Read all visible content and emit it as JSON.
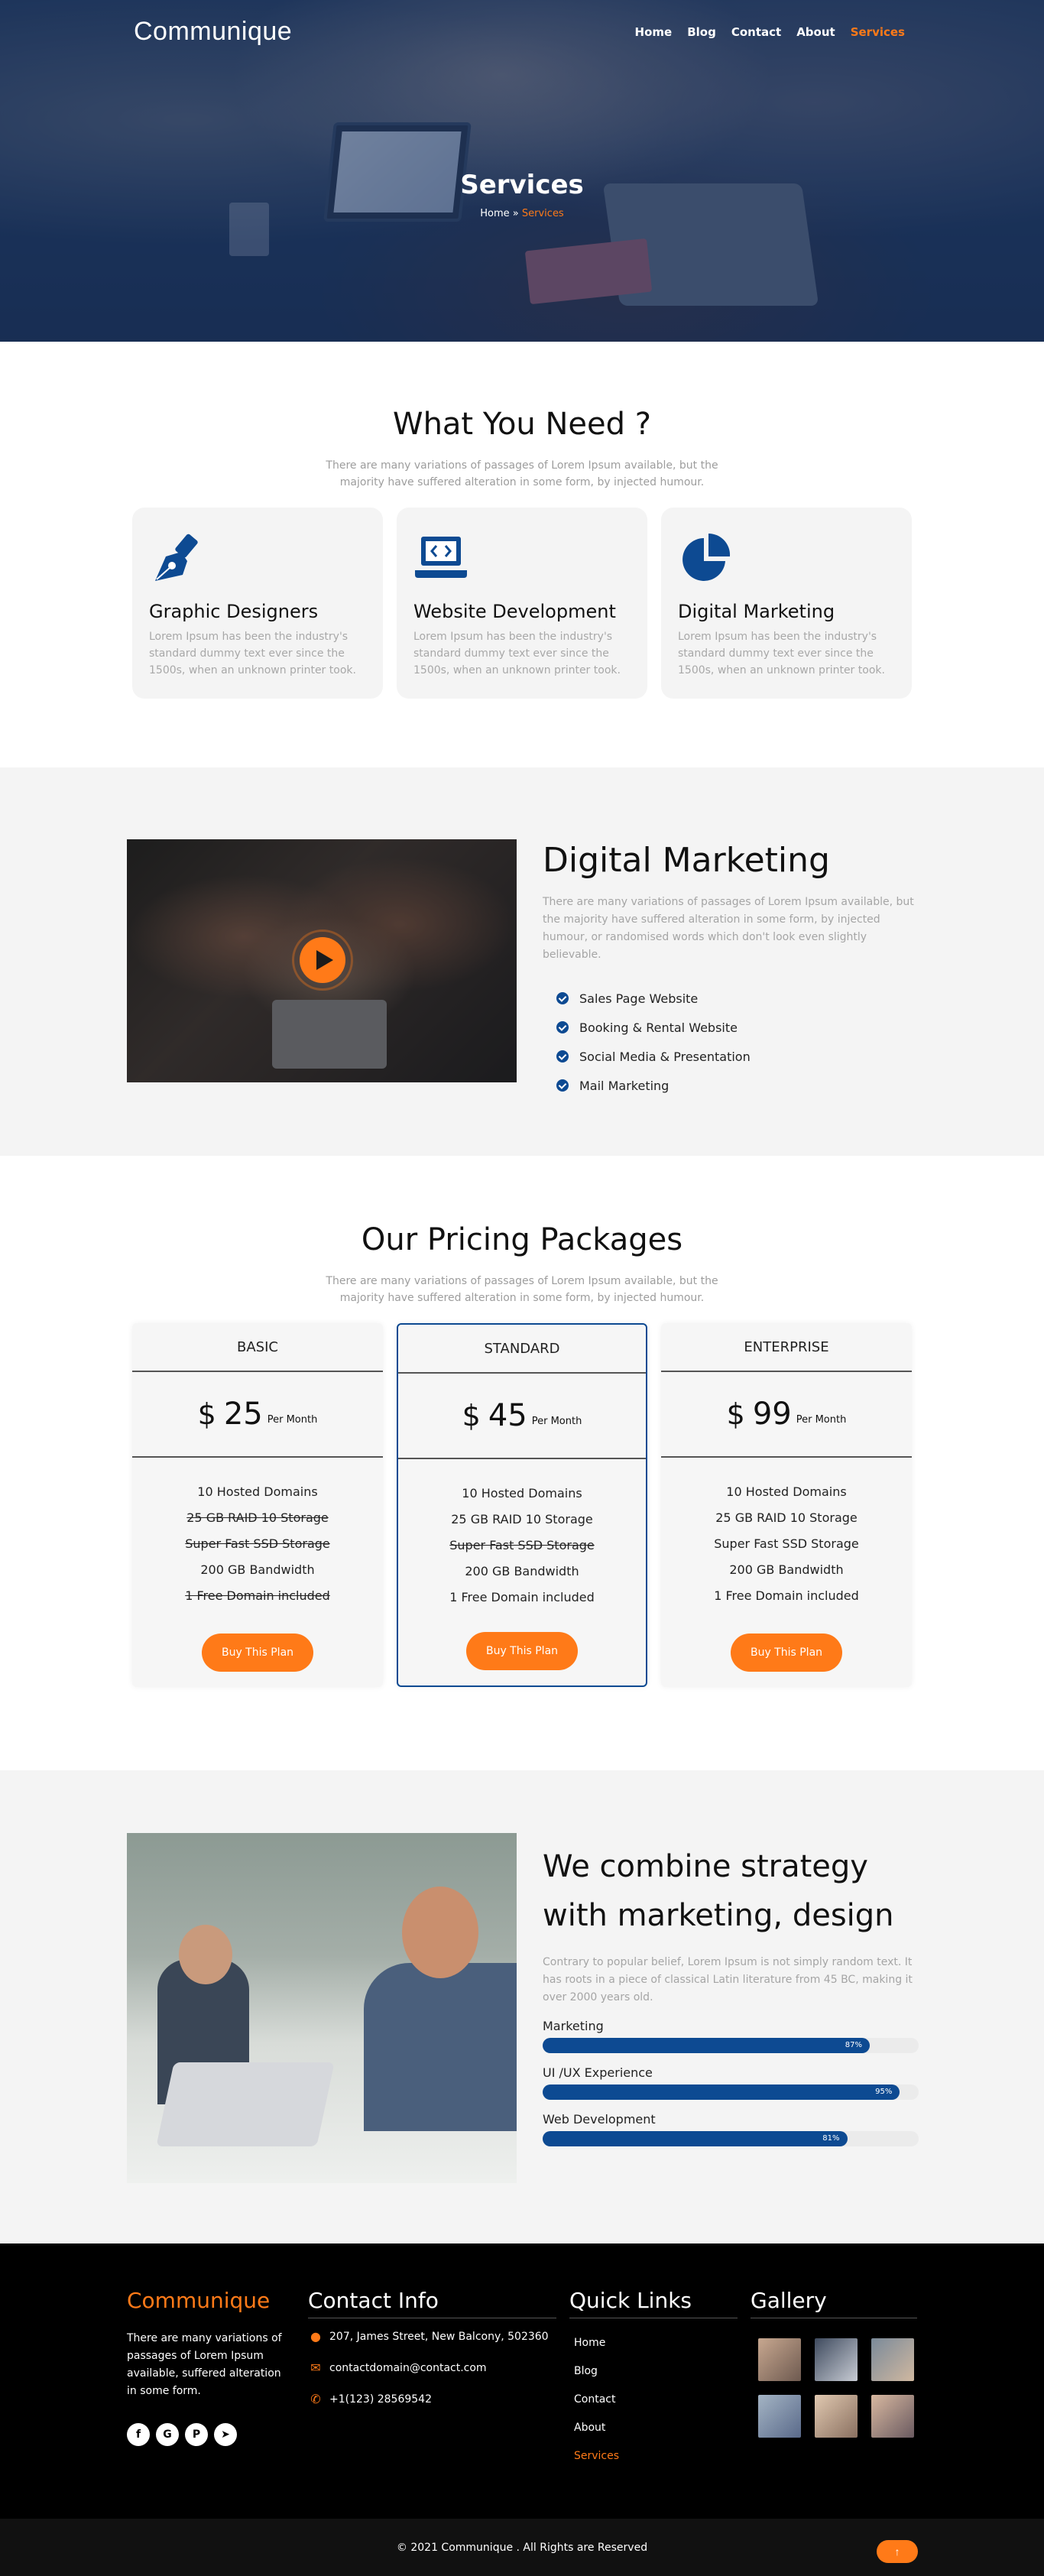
{
  "brand": "Communique",
  "nav": {
    "items": [
      {
        "label": "Home",
        "active": false
      },
      {
        "label": "Blog",
        "active": false
      },
      {
        "label": "Contact",
        "active": false
      },
      {
        "label": "About",
        "active": false
      },
      {
        "label": "Services",
        "active": true
      }
    ]
  },
  "hero": {
    "title": "Services",
    "breadcrumb_home": "Home",
    "breadcrumb_sep": " » ",
    "breadcrumb_current": "Services"
  },
  "services": {
    "title": "What You Need ?",
    "subtitle": "There are many variations of passages of Lorem Ipsum available, but the majority have suffered alteration in some form, by injected humour.",
    "cards": [
      {
        "icon": "pen-nib-icon",
        "title": "Graphic Designers",
        "text": "Lorem Ipsum has been the industry's standard dummy text ever since the 1500s, when an unknown printer took."
      },
      {
        "icon": "laptop-code-icon",
        "title": "Website Development",
        "text": "Lorem Ipsum has been the industry's standard dummy text ever since the 1500s, when an unknown printer took."
      },
      {
        "icon": "pie-chart-icon",
        "title": "Digital Marketing",
        "text": "Lorem Ipsum has been the industry's standard dummy text ever since the 1500s, when an unknown printer took."
      }
    ]
  },
  "digital_marketing": {
    "title": "Digital Marketing",
    "text": "There are many variations of passages of Lorem Ipsum available, but the majority have suffered alteration in some form, by injected humour, or randomised words which don't look even slightly believable.",
    "list": [
      "Sales Page Website",
      "Booking & Rental Website",
      "Social Media & Presentation",
      "Mail Marketing"
    ]
  },
  "pricing": {
    "title": "Our Pricing Packages",
    "subtitle": "There are many variations of passages of Lorem Ipsum available, but the majority have suffered alteration in some form, by injected humour.",
    "plans": [
      {
        "name": "BASIC",
        "currency": "$",
        "price": "25",
        "period": "Per Month",
        "button": "Buy This Plan",
        "features": [
          {
            "text": "10 Hosted Domains",
            "included": true
          },
          {
            "text": "25 GB RAID 10 Storage",
            "included": false
          },
          {
            "text": "Super Fast SSD Storage",
            "included": false
          },
          {
            "text": "200 GB Bandwidth",
            "included": true
          },
          {
            "text": "1 Free Domain included",
            "included": false
          }
        ]
      },
      {
        "name": "STANDARD",
        "currency": "$",
        "price": "45",
        "period": "Per Month",
        "button": "Buy This Plan",
        "features": [
          {
            "text": "10 Hosted Domains",
            "included": true
          },
          {
            "text": "25 GB RAID 10 Storage",
            "included": true
          },
          {
            "text": "Super Fast SSD Storage",
            "included": false
          },
          {
            "text": "200 GB Bandwidth",
            "included": true
          },
          {
            "text": "1 Free Domain included",
            "included": true
          }
        ]
      },
      {
        "name": "ENTERPRISE",
        "currency": "$",
        "price": "99",
        "period": "Per Month",
        "button": "Buy This Plan",
        "features": [
          {
            "text": "10 Hosted Domains",
            "included": true
          },
          {
            "text": "25 GB RAID 10 Storage",
            "included": true
          },
          {
            "text": "Super Fast SSD Storage",
            "included": true
          },
          {
            "text": "200 GB Bandwidth",
            "included": true
          },
          {
            "text": "1 Free Domain included",
            "included": true
          }
        ]
      }
    ]
  },
  "strategy": {
    "title": "We combine strategy with marketing, design",
    "text": "Contrary to popular belief, Lorem Ipsum is not simply random text. It has roots in a piece of classical Latin literature from 45 BC, making it over 2000 years old.",
    "skills": [
      {
        "label": "Marketing",
        "percent": 87,
        "percent_label": "87%"
      },
      {
        "label": "UI /UX Experience",
        "percent": 95,
        "percent_label": "95%"
      },
      {
        "label": "Web Development",
        "percent": 81,
        "percent_label": "81%"
      }
    ]
  },
  "footer": {
    "brand": "Communique",
    "about": "There are many variations of passages of Lorem Ipsum available, suffered alteration in some form.",
    "socials": [
      "facebook-icon",
      "google-plus-icon",
      "pinterest-icon",
      "telegram-icon"
    ],
    "contact_title": "Contact Info",
    "contact": [
      {
        "icon": "location-pin-icon",
        "text": "207, James Street, New Balcony, 502360"
      },
      {
        "icon": "envelope-icon",
        "text": "contactdomain@contact.com"
      },
      {
        "icon": "phone-icon",
        "text": "+1(123) 28569542"
      }
    ],
    "links_title": "Quick Links",
    "links": [
      {
        "label": "Home",
        "current": false
      },
      {
        "label": "Blog",
        "current": false
      },
      {
        "label": "Contact",
        "current": false
      },
      {
        "label": "About",
        "current": false
      },
      {
        "label": "Services",
        "current": true
      }
    ],
    "gallery_title": "Gallery",
    "gallery_count": 6,
    "copyright": "© 2021 Communique . All Rights are Reserved"
  },
  "colors": {
    "accent": "#ff7a18",
    "primary": "#0d4a92",
    "footer_bg": "#000000"
  }
}
